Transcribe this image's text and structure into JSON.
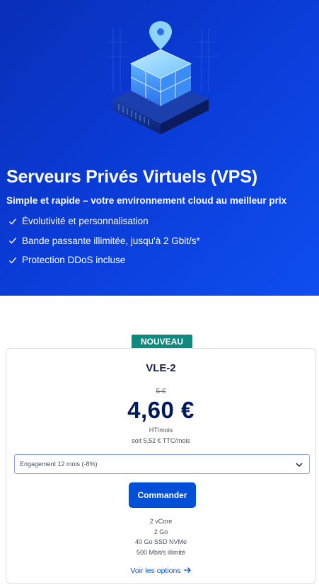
{
  "hero": {
    "title": "Serveurs Privés Virtuels (VPS)",
    "subtitle": "Simple et rapide – votre environnement cloud au meilleur prix",
    "features": [
      "Évolutivité et personnalisation",
      "Bande passante illimitée, jusqu'à 2 Gbit/s*",
      "Protection DDoS incluse"
    ],
    "illustration_icon": "server-cube-illustration",
    "colors": {
      "background": "#0a3bd6",
      "text": "#ffffff"
    }
  },
  "offer": {
    "badge": "NOUVEAU",
    "badge_color": "#0f8a7f",
    "plan_name": "VLE-2",
    "old_price": "5 €",
    "price": "4,60 €",
    "price_unit": "HT/mois",
    "price_ttc": "soit 5,52 € TTC/mois",
    "engagement_select": {
      "selected": "Engagement 12 mois (-8%)"
    },
    "order_button": "Commander",
    "specs": [
      "2 vCore",
      "2 Go",
      "40 Go SSD NVMe",
      "500 Mbit/s illimité"
    ],
    "options_link": "Voir les options",
    "accent_color": "#0050d7"
  }
}
